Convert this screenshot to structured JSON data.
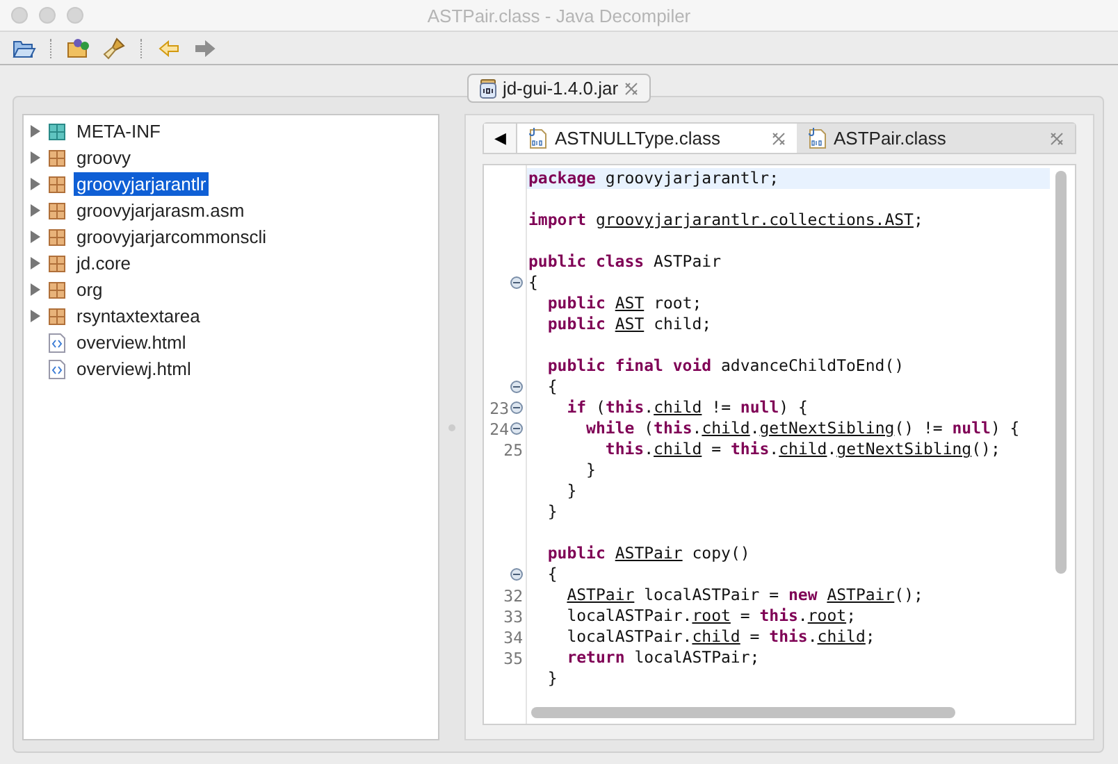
{
  "window": {
    "title": "ASTPair.class - Java Decompiler"
  },
  "toolbar": {
    "forward_disabled": true
  },
  "file_tabs": [
    {
      "label": "jd-gui-1.4.0.jar",
      "selected": true
    }
  ],
  "tree": {
    "items": [
      {
        "label": "META-INF",
        "kind": "folder",
        "expanded": false,
        "selected": false
      },
      {
        "label": "groovy",
        "kind": "package",
        "expanded": false,
        "selected": false
      },
      {
        "label": "groovyjarjarantlr",
        "kind": "package",
        "expanded": false,
        "selected": true
      },
      {
        "label": "groovyjarjarasm.asm",
        "kind": "package",
        "expanded": false,
        "selected": false
      },
      {
        "label": "groovyjarjarcommonscli",
        "kind": "package",
        "expanded": false,
        "selected": false
      },
      {
        "label": "jd.core",
        "kind": "package",
        "expanded": false,
        "selected": false
      },
      {
        "label": "org",
        "kind": "package",
        "expanded": false,
        "selected": false
      },
      {
        "label": "rsyntaxtextarea",
        "kind": "package",
        "expanded": false,
        "selected": false
      },
      {
        "label": "overview.html",
        "kind": "file",
        "selected": false
      },
      {
        "label": "overviewj.html",
        "kind": "file",
        "selected": false
      }
    ]
  },
  "editor_tabs": {
    "scroll_left": "◀",
    "tabs": [
      {
        "label": "ASTNULLType.class",
        "selected": false
      },
      {
        "label": "ASTPair.class",
        "selected": true
      }
    ]
  },
  "code": {
    "lines": [
      {
        "kind": "code",
        "current": true,
        "tokens": [
          {
            "kind": "keyword",
            "text": "package"
          },
          {
            "kind": "plain",
            "text": " groovyjarjarantlr;"
          }
        ]
      },
      {
        "kind": "blank"
      },
      {
        "kind": "code",
        "current": false,
        "tokens": [
          {
            "kind": "keyword",
            "text": "import"
          },
          {
            "kind": "reference",
            "text": " groovyjarjarantlr.collections.AST"
          },
          {
            "kind": "plain",
            "text": ";"
          }
        ]
      },
      {
        "kind": "blank"
      },
      {
        "kind": "code",
        "current": false,
        "tokens": [
          {
            "kind": "keyword",
            "text": "public class"
          },
          {
            "kind": "plain",
            "text": " ASTPair"
          }
        ]
      },
      {
        "kind": "code",
        "current": false,
        "fold": true,
        "tokens": [
          {
            "kind": "plain",
            "text": "{"
          }
        ]
      },
      {
        "kind": "code",
        "current": false,
        "tokens": [
          {
            "kind": "keyword",
            "text": "  public"
          },
          {
            "kind": "reference",
            "text": " AST"
          },
          {
            "kind": "plain",
            "text": " root;"
          }
        ]
      },
      {
        "kind": "code",
        "current": false,
        "tokens": [
          {
            "kind": "keyword",
            "text": "  public"
          },
          {
            "kind": "reference",
            "text": " AST"
          },
          {
            "kind": "plain",
            "text": " child;"
          }
        ]
      },
      {
        "kind": "blank"
      },
      {
        "kind": "code",
        "current": false,
        "tokens": [
          {
            "kind": "keyword",
            "text": "  public final void"
          },
          {
            "kind": "plain",
            "text": " advanceChildToEnd()"
          }
        ]
      },
      {
        "kind": "code",
        "current": false,
        "fold": true,
        "tokens": [
          {
            "kind": "plain",
            "text": "  {"
          }
        ]
      },
      {
        "kind": "code",
        "current": false,
        "number": "23",
        "fold": true,
        "tokens": [
          {
            "kind": "keyword",
            "text": "    if"
          },
          {
            "kind": "plain",
            "text": " ("
          },
          {
            "kind": "keyword",
            "text": "this"
          },
          {
            "kind": "plain",
            "text": "."
          },
          {
            "kind": "reference",
            "text": "child"
          },
          {
            "kind": "plain",
            "text": " != "
          },
          {
            "kind": "keyword",
            "text": "null"
          },
          {
            "kind": "plain",
            "text": ") {"
          }
        ]
      },
      {
        "kind": "code",
        "current": false,
        "number": "24",
        "fold": true,
        "tokens": [
          {
            "kind": "keyword",
            "text": "      while"
          },
          {
            "kind": "plain",
            "text": " ("
          },
          {
            "kind": "keyword",
            "text": "this"
          },
          {
            "kind": "plain",
            "text": "."
          },
          {
            "kind": "reference",
            "text": "child"
          },
          {
            "kind": "plain",
            "text": "."
          },
          {
            "kind": "reference",
            "text": "getNextSibling"
          },
          {
            "kind": "plain",
            "text": "() != "
          },
          {
            "kind": "keyword",
            "text": "null"
          },
          {
            "kind": "plain",
            "text": ") {"
          }
        ]
      },
      {
        "kind": "code",
        "current": false,
        "number": "25",
        "tokens": [
          {
            "kind": "keyword",
            "text": "        this"
          },
          {
            "kind": "plain",
            "text": "."
          },
          {
            "kind": "reference",
            "text": "child"
          },
          {
            "kind": "plain",
            "text": " = "
          },
          {
            "kind": "keyword",
            "text": "this"
          },
          {
            "kind": "plain",
            "text": "."
          },
          {
            "kind": "reference",
            "text": "child"
          },
          {
            "kind": "plain",
            "text": "."
          },
          {
            "kind": "reference",
            "text": "getNextSibling"
          },
          {
            "kind": "plain",
            "text": "();"
          }
        ]
      },
      {
        "kind": "code",
        "current": false,
        "tokens": [
          {
            "kind": "plain",
            "text": "      }"
          }
        ]
      },
      {
        "kind": "code",
        "current": false,
        "tokens": [
          {
            "kind": "plain",
            "text": "    }"
          }
        ]
      },
      {
        "kind": "code",
        "current": false,
        "tokens": [
          {
            "kind": "plain",
            "text": "  }"
          }
        ]
      },
      {
        "kind": "blank"
      },
      {
        "kind": "code",
        "current": false,
        "tokens": [
          {
            "kind": "keyword",
            "text": "  public"
          },
          {
            "kind": "reference",
            "text": " ASTPair"
          },
          {
            "kind": "plain",
            "text": " copy()"
          }
        ]
      },
      {
        "kind": "code",
        "current": false,
        "fold": true,
        "tokens": [
          {
            "kind": "plain",
            "text": "  {"
          }
        ]
      },
      {
        "kind": "code",
        "current": false,
        "number": "32",
        "tokens": [
          {
            "kind": "reference",
            "text": "    ASTPair"
          },
          {
            "kind": "plain",
            "text": " localASTPair = "
          },
          {
            "kind": "keyword",
            "text": "new"
          },
          {
            "kind": "reference",
            "text": " ASTPair"
          },
          {
            "kind": "plain",
            "text": "();"
          }
        ]
      },
      {
        "kind": "code",
        "current": false,
        "number": "33",
        "tokens": [
          {
            "kind": "plain",
            "text": "    localASTPair."
          },
          {
            "kind": "reference",
            "text": "root"
          },
          {
            "kind": "plain",
            "text": " = "
          },
          {
            "kind": "keyword",
            "text": "this"
          },
          {
            "kind": "plain",
            "text": "."
          },
          {
            "kind": "reference",
            "text": "root"
          },
          {
            "kind": "plain",
            "text": ";"
          }
        ]
      },
      {
        "kind": "code",
        "current": false,
        "number": "34",
        "tokens": [
          {
            "kind": "plain",
            "text": "    localASTPair."
          },
          {
            "kind": "reference",
            "text": "child"
          },
          {
            "kind": "plain",
            "text": " = "
          },
          {
            "kind": "keyword",
            "text": "this"
          },
          {
            "kind": "plain",
            "text": "."
          },
          {
            "kind": "reference",
            "text": "child"
          },
          {
            "kind": "plain",
            "text": ";"
          }
        ]
      },
      {
        "kind": "code",
        "current": false,
        "number": "35",
        "tokens": [
          {
            "kind": "keyword",
            "text": "    return"
          },
          {
            "kind": "plain",
            "text": " localASTPair;"
          }
        ]
      },
      {
        "kind": "code",
        "current": false,
        "tokens": [
          {
            "kind": "plain",
            "text": "  }"
          }
        ]
      }
    ]
  }
}
